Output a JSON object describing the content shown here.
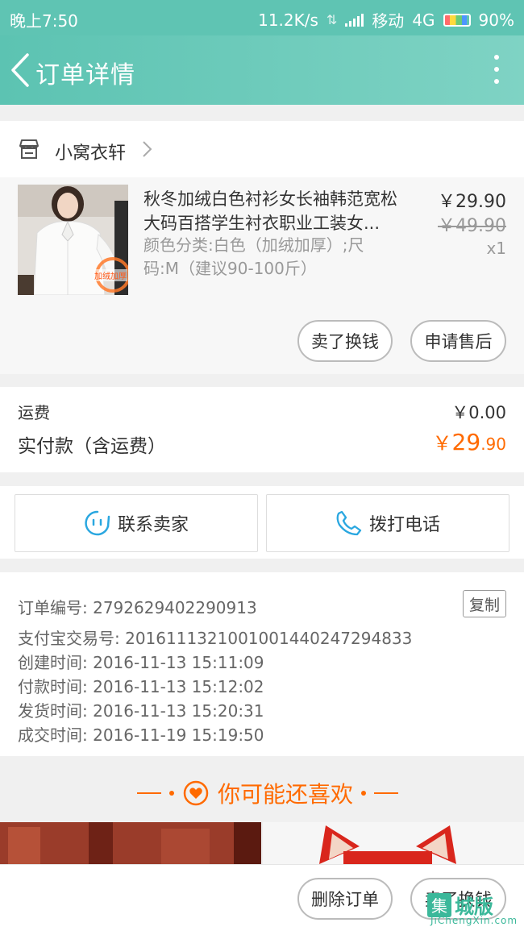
{
  "status_bar": {
    "time": "晚上7:50",
    "net_speed": "11.2K/s",
    "carrier": "移动",
    "network": "4G",
    "battery": "90%"
  },
  "header": {
    "title": "订单详情",
    "back_icon": "chevron-left-icon",
    "more_icon": "more-vertical-icon"
  },
  "shop": {
    "name": "小窝衣轩",
    "icon": "store-icon"
  },
  "product": {
    "title": "秋冬加绒白色衬衫女长袖韩范宽松大码百搭学生衬衣职业工装女...",
    "spec": "颜色分类:白色（加绒加厚）;尺码:M（建议90-100斤）",
    "price": "￥29.90",
    "original_price": "￥49.90",
    "quantity": "x1",
    "badge": "加绒加厚",
    "actions": [
      "卖了换钱",
      "申请售后"
    ]
  },
  "fees": {
    "shipping_label": "运费",
    "shipping_value": "￥0.00",
    "paid_label": "实付款（含运费）",
    "paid_symbol": "￥",
    "paid_int": "29",
    "paid_dec": ".90"
  },
  "contact": {
    "seller_label": "联系卖家",
    "phone_label": "拨打电话"
  },
  "order_info": {
    "order_no": "订单编号: 2792629402290913",
    "copy_label": "复制",
    "alipay_no": "支付宝交易号: 2016111321001001440247294833",
    "created": "创建时间: 2016-11-13 15:11:09",
    "paid": "付款时间: 2016-11-13 15:12:02",
    "shipped": "发货时间: 2016-11-13 15:20:31",
    "completed": "成交时间: 2016-11-19 15:19:50"
  },
  "recommend": {
    "title": "你可能还喜欢"
  },
  "bottom_bar": {
    "delete_label": "删除订单",
    "sell_label": "卖了换钱"
  },
  "watermark": {
    "box_char": "集",
    "text": "城版",
    "url": "JiChengXin.com"
  },
  "colors": {
    "header": "#5fc4b3",
    "accent_orange": "#ff6a00",
    "contact_blue": "#2aa7e0"
  }
}
